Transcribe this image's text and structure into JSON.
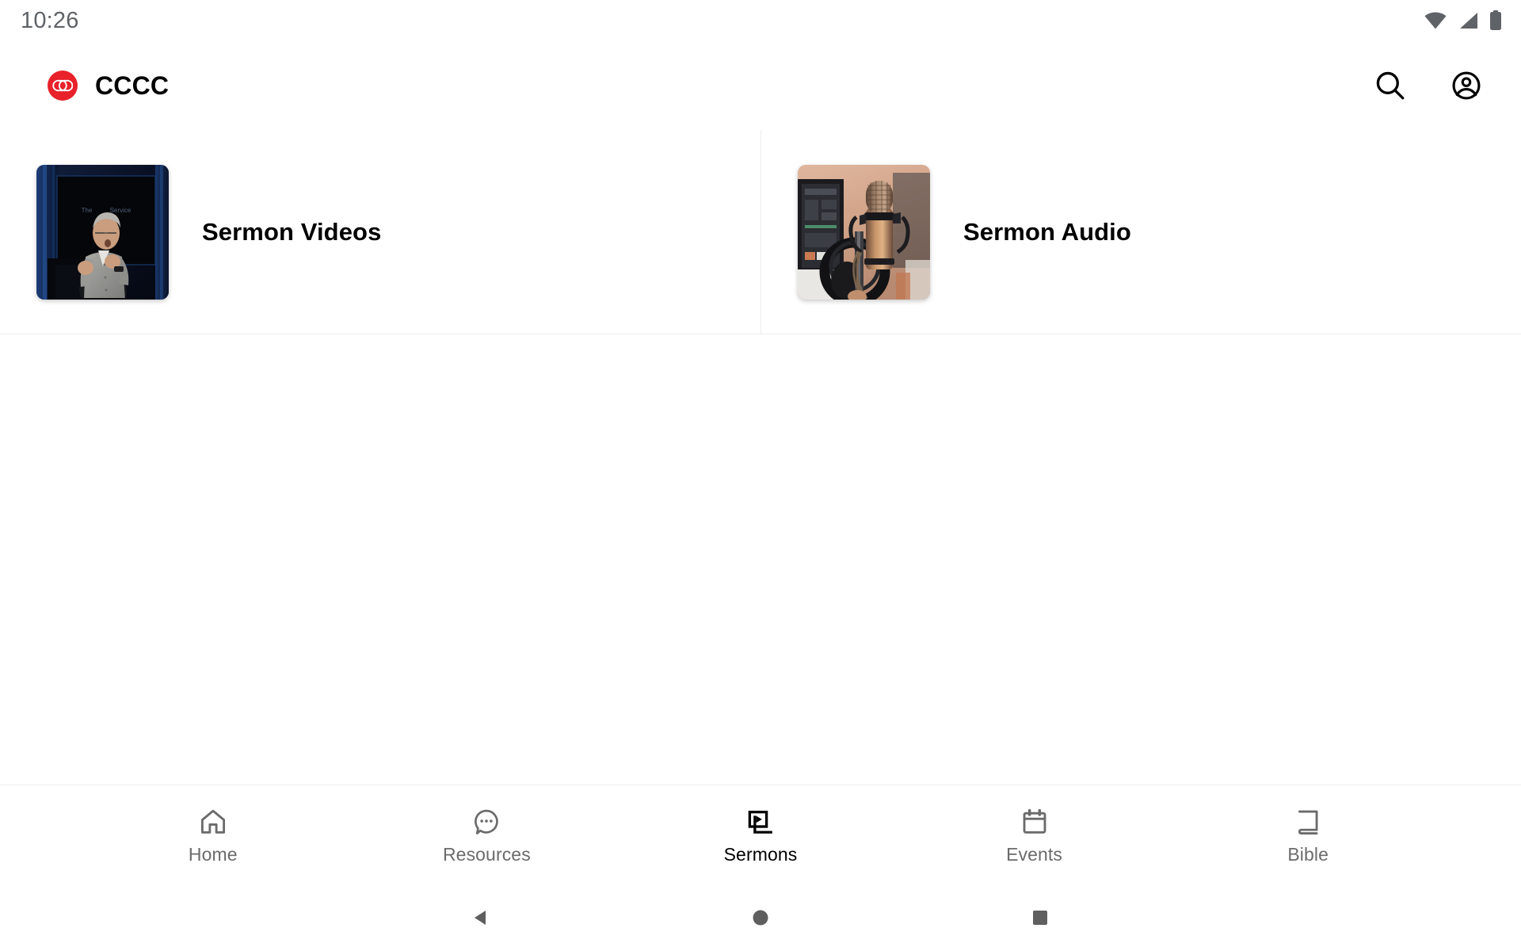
{
  "status_bar": {
    "clock": "10:26",
    "icons": [
      "wifi-icon",
      "cell-signal-icon",
      "battery-icon"
    ],
    "icon_color": "#5f6368"
  },
  "app_bar": {
    "logo_icon": "cccc-monogram-logo",
    "logo_color": "#e8212b",
    "title": "CCCC",
    "actions": [
      {
        "icon": "search-icon",
        "label": "Search"
      },
      {
        "icon": "account-circle-icon",
        "label": "Account"
      }
    ]
  },
  "main": {
    "cards": [
      {
        "title": "Sermon Videos",
        "thumb_icon": "speaker-on-stage-thumbnail",
        "thumb_alt": "Man in grey shirt speaking on a dark stage"
      },
      {
        "title": "Sermon Audio",
        "thumb_icon": "studio-microphone-thumbnail",
        "thumb_alt": "Condenser microphone and headphones in a studio"
      }
    ]
  },
  "bottom_nav": {
    "active_index": 2,
    "items": [
      {
        "label": "Home",
        "icon": "home-icon"
      },
      {
        "label": "Resources",
        "icon": "chat-bubble-dots-icon"
      },
      {
        "label": "Sermons",
        "icon": "video-library-icon"
      },
      {
        "label": "Events",
        "icon": "calendar-icon"
      },
      {
        "label": "Bible",
        "icon": "book-icon"
      }
    ],
    "inactive_color": "#6b6b6b",
    "active_color": "#000000"
  },
  "system_nav": {
    "buttons": [
      {
        "name": "back-button",
        "icon": "triangle-back-icon"
      },
      {
        "name": "home-button",
        "icon": "circle-home-icon"
      },
      {
        "name": "recents-button",
        "icon": "square-recents-icon"
      }
    ],
    "color": "#5f5f5f"
  }
}
